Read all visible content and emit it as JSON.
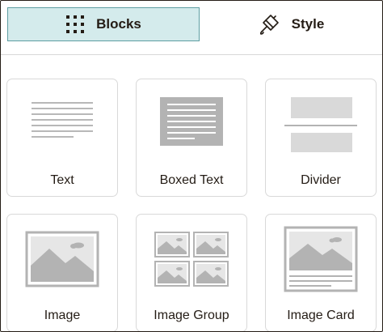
{
  "tabs": {
    "blocks": {
      "label": "Blocks",
      "icon": "grid-dots-icon",
      "active": true
    },
    "style": {
      "label": "Style",
      "icon": "paint-brush-icon",
      "active": false
    }
  },
  "blocks": [
    {
      "label": "Text",
      "icon": "text-lines-icon"
    },
    {
      "label": "Boxed Text",
      "icon": "boxed-text-icon"
    },
    {
      "label": "Divider",
      "icon": "divider-icon"
    },
    {
      "label": "Image",
      "icon": "image-icon"
    },
    {
      "label": "Image Group",
      "icon": "image-group-icon"
    },
    {
      "label": "Image Card",
      "icon": "image-card-icon"
    }
  ],
  "colors": {
    "active_tab_bg": "#d4ebec",
    "active_tab_border": "#5e9ea2",
    "icon_gray": "#b3b3b3",
    "text": "#241c15"
  }
}
